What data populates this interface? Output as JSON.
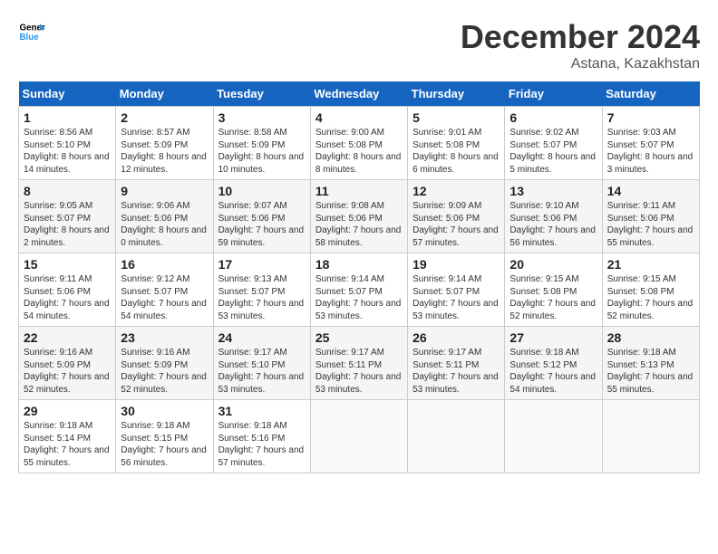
{
  "header": {
    "logo_line1": "General",
    "logo_line2": "Blue",
    "month": "December 2024",
    "location": "Astana, Kazakhstan"
  },
  "weekdays": [
    "Sunday",
    "Monday",
    "Tuesday",
    "Wednesday",
    "Thursday",
    "Friday",
    "Saturday"
  ],
  "weeks": [
    [
      {
        "day": "1",
        "sunrise": "Sunrise: 8:56 AM",
        "sunset": "Sunset: 5:10 PM",
        "daylight": "Daylight: 8 hours and 14 minutes."
      },
      {
        "day": "2",
        "sunrise": "Sunrise: 8:57 AM",
        "sunset": "Sunset: 5:09 PM",
        "daylight": "Daylight: 8 hours and 12 minutes."
      },
      {
        "day": "3",
        "sunrise": "Sunrise: 8:58 AM",
        "sunset": "Sunset: 5:09 PM",
        "daylight": "Daylight: 8 hours and 10 minutes."
      },
      {
        "day": "4",
        "sunrise": "Sunrise: 9:00 AM",
        "sunset": "Sunset: 5:08 PM",
        "daylight": "Daylight: 8 hours and 8 minutes."
      },
      {
        "day": "5",
        "sunrise": "Sunrise: 9:01 AM",
        "sunset": "Sunset: 5:08 PM",
        "daylight": "Daylight: 8 hours and 6 minutes."
      },
      {
        "day": "6",
        "sunrise": "Sunrise: 9:02 AM",
        "sunset": "Sunset: 5:07 PM",
        "daylight": "Daylight: 8 hours and 5 minutes."
      },
      {
        "day": "7",
        "sunrise": "Sunrise: 9:03 AM",
        "sunset": "Sunset: 5:07 PM",
        "daylight": "Daylight: 8 hours and 3 minutes."
      }
    ],
    [
      {
        "day": "8",
        "sunrise": "Sunrise: 9:05 AM",
        "sunset": "Sunset: 5:07 PM",
        "daylight": "Daylight: 8 hours and 2 minutes."
      },
      {
        "day": "9",
        "sunrise": "Sunrise: 9:06 AM",
        "sunset": "Sunset: 5:06 PM",
        "daylight": "Daylight: 8 hours and 0 minutes."
      },
      {
        "day": "10",
        "sunrise": "Sunrise: 9:07 AM",
        "sunset": "Sunset: 5:06 PM",
        "daylight": "Daylight: 7 hours and 59 minutes."
      },
      {
        "day": "11",
        "sunrise": "Sunrise: 9:08 AM",
        "sunset": "Sunset: 5:06 PM",
        "daylight": "Daylight: 7 hours and 58 minutes."
      },
      {
        "day": "12",
        "sunrise": "Sunrise: 9:09 AM",
        "sunset": "Sunset: 5:06 PM",
        "daylight": "Daylight: 7 hours and 57 minutes."
      },
      {
        "day": "13",
        "sunrise": "Sunrise: 9:10 AM",
        "sunset": "Sunset: 5:06 PM",
        "daylight": "Daylight: 7 hours and 56 minutes."
      },
      {
        "day": "14",
        "sunrise": "Sunrise: 9:11 AM",
        "sunset": "Sunset: 5:06 PM",
        "daylight": "Daylight: 7 hours and 55 minutes."
      }
    ],
    [
      {
        "day": "15",
        "sunrise": "Sunrise: 9:11 AM",
        "sunset": "Sunset: 5:06 PM",
        "daylight": "Daylight: 7 hours and 54 minutes."
      },
      {
        "day": "16",
        "sunrise": "Sunrise: 9:12 AM",
        "sunset": "Sunset: 5:07 PM",
        "daylight": "Daylight: 7 hours and 54 minutes."
      },
      {
        "day": "17",
        "sunrise": "Sunrise: 9:13 AM",
        "sunset": "Sunset: 5:07 PM",
        "daylight": "Daylight: 7 hours and 53 minutes."
      },
      {
        "day": "18",
        "sunrise": "Sunrise: 9:14 AM",
        "sunset": "Sunset: 5:07 PM",
        "daylight": "Daylight: 7 hours and 53 minutes."
      },
      {
        "day": "19",
        "sunrise": "Sunrise: 9:14 AM",
        "sunset": "Sunset: 5:07 PM",
        "daylight": "Daylight: 7 hours and 53 minutes."
      },
      {
        "day": "20",
        "sunrise": "Sunrise: 9:15 AM",
        "sunset": "Sunset: 5:08 PM",
        "daylight": "Daylight: 7 hours and 52 minutes."
      },
      {
        "day": "21",
        "sunrise": "Sunrise: 9:15 AM",
        "sunset": "Sunset: 5:08 PM",
        "daylight": "Daylight: 7 hours and 52 minutes."
      }
    ],
    [
      {
        "day": "22",
        "sunrise": "Sunrise: 9:16 AM",
        "sunset": "Sunset: 5:09 PM",
        "daylight": "Daylight: 7 hours and 52 minutes."
      },
      {
        "day": "23",
        "sunrise": "Sunrise: 9:16 AM",
        "sunset": "Sunset: 5:09 PM",
        "daylight": "Daylight: 7 hours and 52 minutes."
      },
      {
        "day": "24",
        "sunrise": "Sunrise: 9:17 AM",
        "sunset": "Sunset: 5:10 PM",
        "daylight": "Daylight: 7 hours and 53 minutes."
      },
      {
        "day": "25",
        "sunrise": "Sunrise: 9:17 AM",
        "sunset": "Sunset: 5:11 PM",
        "daylight": "Daylight: 7 hours and 53 minutes."
      },
      {
        "day": "26",
        "sunrise": "Sunrise: 9:17 AM",
        "sunset": "Sunset: 5:11 PM",
        "daylight": "Daylight: 7 hours and 53 minutes."
      },
      {
        "day": "27",
        "sunrise": "Sunrise: 9:18 AM",
        "sunset": "Sunset: 5:12 PM",
        "daylight": "Daylight: 7 hours and 54 minutes."
      },
      {
        "day": "28",
        "sunrise": "Sunrise: 9:18 AM",
        "sunset": "Sunset: 5:13 PM",
        "daylight": "Daylight: 7 hours and 55 minutes."
      }
    ],
    [
      {
        "day": "29",
        "sunrise": "Sunrise: 9:18 AM",
        "sunset": "Sunset: 5:14 PM",
        "daylight": "Daylight: 7 hours and 55 minutes."
      },
      {
        "day": "30",
        "sunrise": "Sunrise: 9:18 AM",
        "sunset": "Sunset: 5:15 PM",
        "daylight": "Daylight: 7 hours and 56 minutes."
      },
      {
        "day": "31",
        "sunrise": "Sunrise: 9:18 AM",
        "sunset": "Sunset: 5:16 PM",
        "daylight": "Daylight: 7 hours and 57 minutes."
      },
      null,
      null,
      null,
      null
    ]
  ]
}
